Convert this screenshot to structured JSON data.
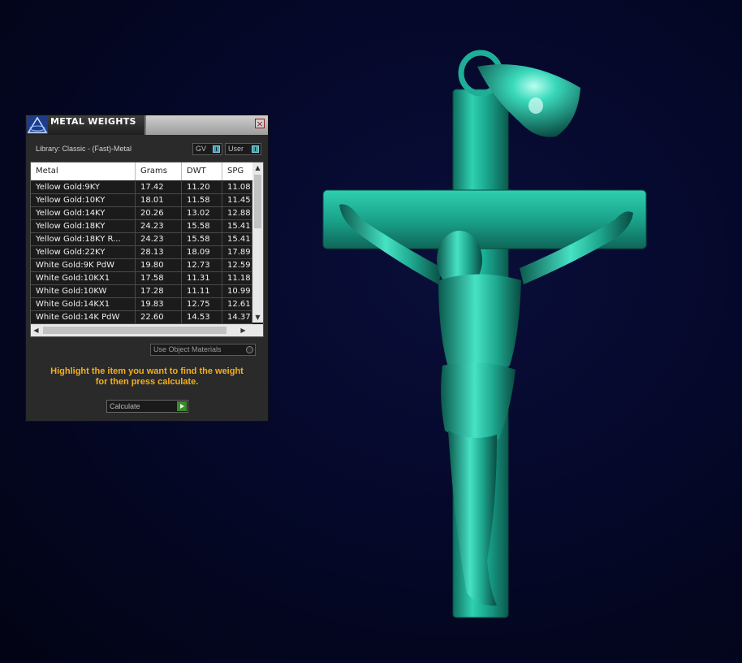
{
  "panel": {
    "title": "METAL WEIGHTS",
    "close": "×",
    "library": "Library: Classic - (Fast)-Metal",
    "toggle_gv": "GV",
    "toggle_user": "User",
    "columns": [
      "Metal",
      "Grams",
      "DWT",
      "SPG"
    ],
    "rows": [
      [
        "Yellow Gold:9KY",
        "17.42",
        "11.20",
        "11.08"
      ],
      [
        "Yellow Gold:10KY",
        "18.01",
        "11.58",
        "11.45"
      ],
      [
        "Yellow Gold:14KY",
        "20.26",
        "13.02",
        "12.88"
      ],
      [
        "Yellow Gold:18KY",
        "24.23",
        "15.58",
        "15.41"
      ],
      [
        "Yellow Gold:18KY R...",
        "24.23",
        "15.58",
        "15.41"
      ],
      [
        "Yellow Gold:22KY",
        "28.13",
        "18.09",
        "17.89"
      ],
      [
        "White Gold:9K PdW",
        "19.80",
        "12.73",
        "12.59"
      ],
      [
        "White Gold:10KX1",
        "17.58",
        "11.31",
        "11.18"
      ],
      [
        "White Gold:10KW",
        "17.28",
        "11.11",
        "10.99"
      ],
      [
        "White Gold:14KX1",
        "19.83",
        "12.75",
        "12.61"
      ],
      [
        "White Gold:14K PdW",
        "22.60",
        "14.53",
        "14.37"
      ]
    ],
    "use_object_materials": "Use Object Materials",
    "hint_line1": "Highlight the item you want to find the weight",
    "hint_line2": "for then press calculate.",
    "calculate": "Calculate"
  },
  "colors": {
    "model": "#1fb59a",
    "hint": "#f2b01e",
    "background": "#05082a"
  }
}
